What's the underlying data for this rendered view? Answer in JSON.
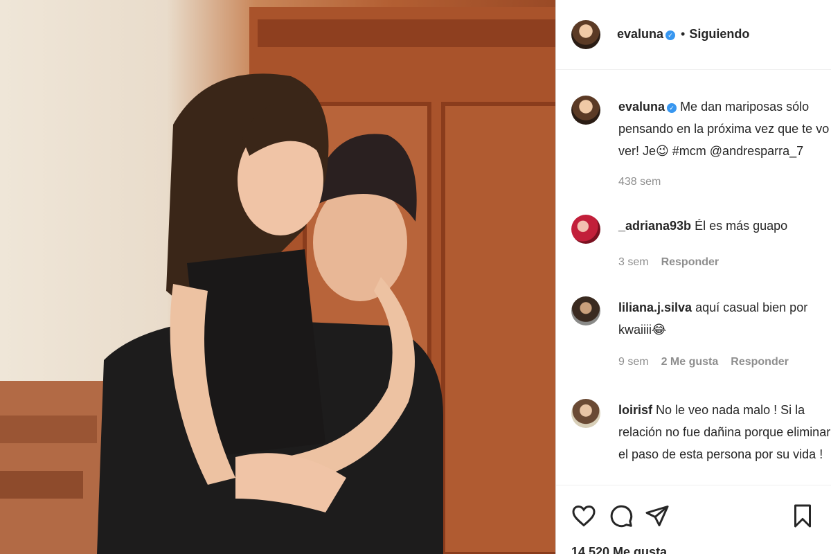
{
  "post": {
    "username": "evaluna",
    "follow_status": "Siguiendo",
    "caption": "Me dan mariposas sólo pensando en la próxima vez que te vo ver! Je😉 #mcm @andresparra_7",
    "caption_time": "438 sem",
    "likes_text": "14.520 Me gusta"
  },
  "comments": [
    {
      "username": "_adriana93b",
      "text": "Él es más guapo",
      "time": "3 sem",
      "likes": "",
      "reply_label": "Responder"
    },
    {
      "username": "liliana.j.silva",
      "text": "aquí casual bien por kwaiiii😂",
      "time": "9 sem",
      "likes": "2 Me gusta",
      "reply_label": "Responder"
    },
    {
      "username": "loirisf",
      "text": "No le veo nada malo ! Si la relación no fue dañina porque eliminar el paso de esta persona por su vida !"
    }
  ],
  "icons": [
    "heart-icon",
    "comment-icon",
    "share-icon",
    "bookmark-icon"
  ],
  "colors": {
    "verified": "#3897f0",
    "muted": "#8e8e8e",
    "text": "#262626"
  }
}
